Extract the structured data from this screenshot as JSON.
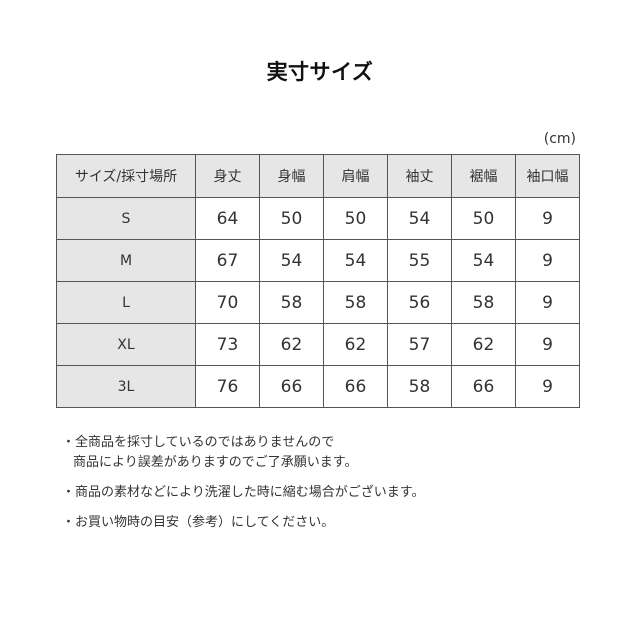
{
  "title": "実寸サイズ",
  "unit": "(cm)",
  "table": {
    "headers": [
      "サイズ/採寸場所",
      "身丈",
      "身幅",
      "肩幅",
      "袖丈",
      "裾幅",
      "袖口幅"
    ],
    "rows": [
      {
        "size": "S",
        "values": [
          "64",
          "50",
          "50",
          "54",
          "50",
          "9"
        ]
      },
      {
        "size": "M",
        "values": [
          "67",
          "54",
          "54",
          "55",
          "54",
          "9"
        ]
      },
      {
        "size": "L",
        "values": [
          "70",
          "58",
          "58",
          "56",
          "58",
          "9"
        ]
      },
      {
        "size": "XL",
        "values": [
          "73",
          "62",
          "62",
          "57",
          "62",
          "9"
        ]
      },
      {
        "size": "3L",
        "values": [
          "76",
          "66",
          "66",
          "58",
          "66",
          "9"
        ]
      }
    ]
  },
  "notes": [
    {
      "line1": "・全商品を採寸しているのではありませんので",
      "line2": "商品により誤差がありますのでご了承願います。"
    },
    {
      "line1": "・商品の素材などにより洗濯した時に縮む場合がございます。",
      "line2": ""
    },
    {
      "line1": "・お買い物時の目安（参考）にしてください。",
      "line2": ""
    }
  ]
}
